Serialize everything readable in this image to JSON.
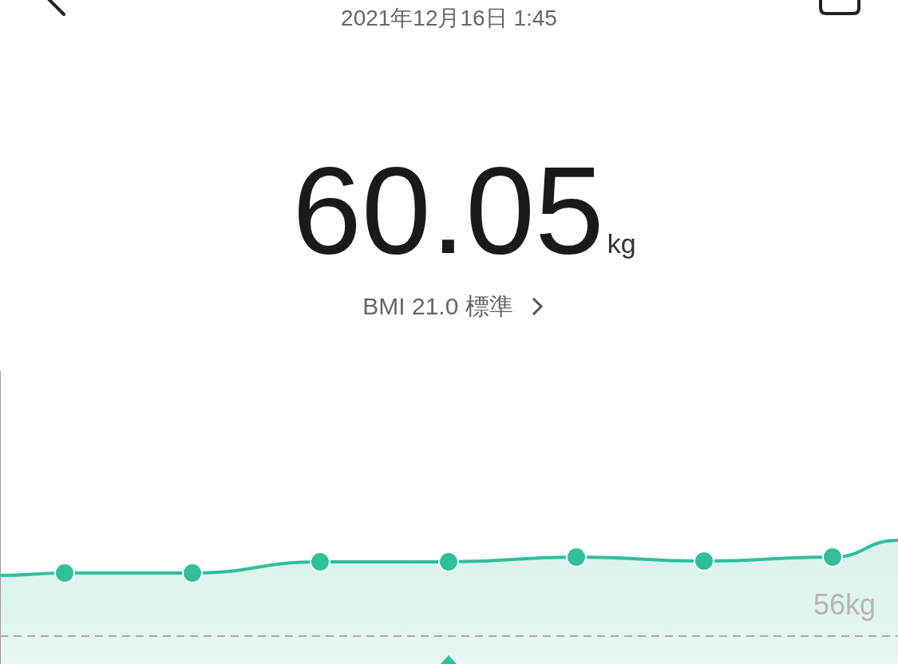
{
  "header": {
    "date": "2021年12月16日 1:45"
  },
  "measurement": {
    "value": "60.05",
    "unit": "kg",
    "bmi_summary": "BMI 21.0 標準"
  },
  "trend_chart": {
    "reference_label": "56kg"
  }
}
